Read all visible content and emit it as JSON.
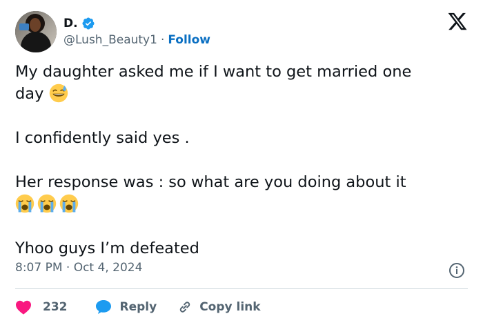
{
  "author": {
    "display_name": "D.",
    "handle": "@Lush_Beauty1",
    "separator": "·",
    "follow_label": "Follow",
    "verified": true,
    "verified_color": "#1d9bf0"
  },
  "brand": {
    "logo": "x-logo-icon"
  },
  "tweet": {
    "line1": "My daughter asked me if I want to get married one",
    "line2": "day",
    "line3": "I confidently said yes .",
    "line4": "Her response was : so what are you doing about it",
    "line5": "Yhoo guys I’m defeated",
    "emojis": [
      "grinning-face-with-sweat-icon",
      "loudly-crying-face-icon",
      "loudly-crying-face-icon",
      "loudly-crying-face-icon"
    ]
  },
  "meta": {
    "timestamp": "8:07 PM · Oct 4, 2024",
    "info_icon": "info-icon"
  },
  "actions": {
    "like_count": "232",
    "reply_label": "Reply",
    "copy_link_label": "Copy link",
    "heart_color": "#f91880",
    "reply_color": "#1d9bf0"
  }
}
